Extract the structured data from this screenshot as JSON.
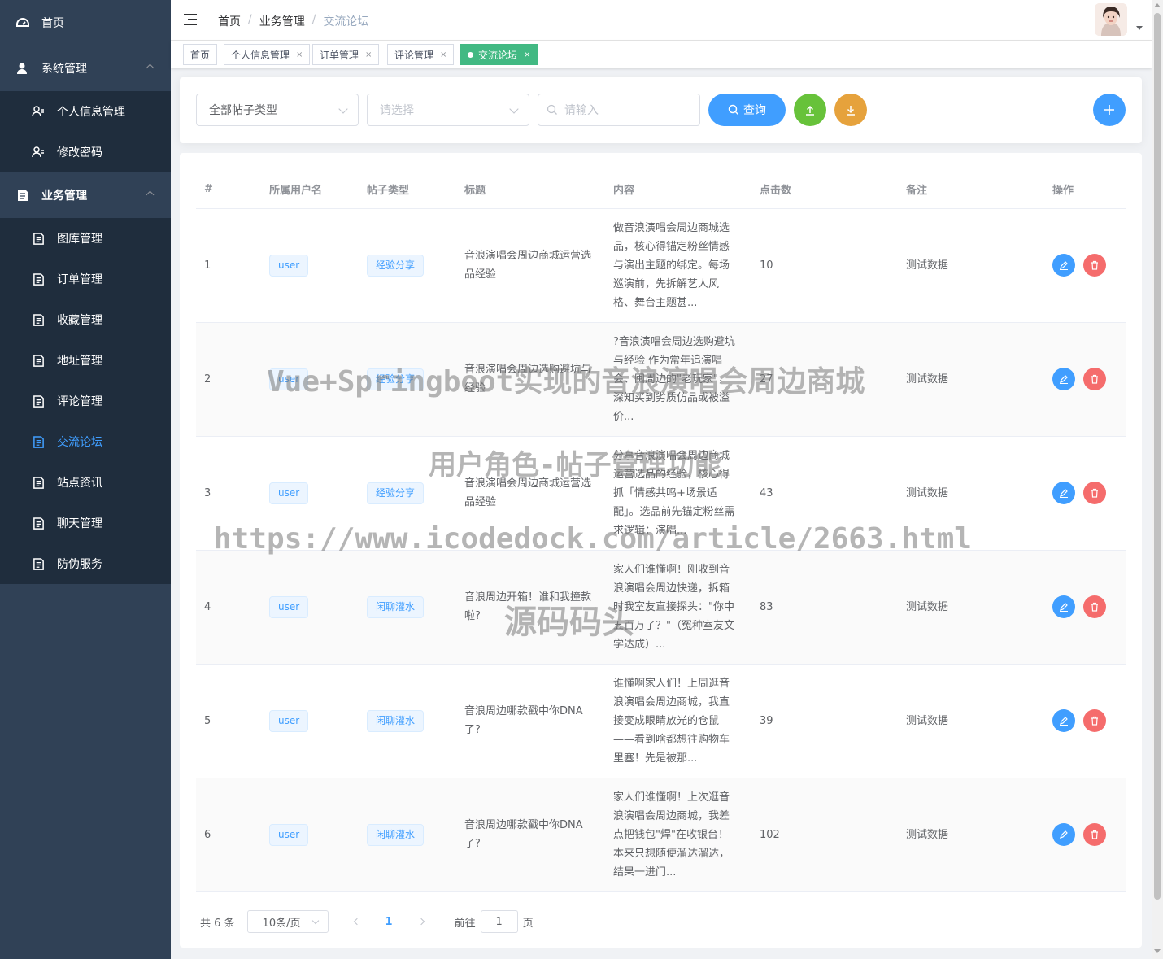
{
  "sidebar": {
    "items": [
      {
        "label": "首页",
        "icon": "dashboard-icon"
      },
      {
        "label": "系统管理",
        "icon": "user-icon",
        "children": [
          {
            "label": "个人信息管理",
            "icon": "peoples-icon"
          },
          {
            "label": "修改密码",
            "icon": "peoples-icon"
          }
        ]
      },
      {
        "label": "业务管理",
        "icon": "form-icon",
        "children": [
          {
            "label": "图库管理",
            "icon": "form-icon"
          },
          {
            "label": "订单管理",
            "icon": "form-icon"
          },
          {
            "label": "收藏管理",
            "icon": "form-icon"
          },
          {
            "label": "地址管理",
            "icon": "form-icon"
          },
          {
            "label": "评论管理",
            "icon": "form-icon"
          },
          {
            "label": "交流论坛",
            "icon": "form-icon",
            "active": true
          },
          {
            "label": "站点资讯",
            "icon": "form-icon"
          },
          {
            "label": "聊天管理",
            "icon": "form-icon"
          },
          {
            "label": "防伪服务",
            "icon": "form-icon"
          }
        ]
      }
    ]
  },
  "breadcrumb": [
    "首页",
    "业务管理",
    "交流论坛"
  ],
  "tags": [
    {
      "label": "首页"
    },
    {
      "label": "个人信息管理",
      "close": "×"
    },
    {
      "label": "订单管理",
      "close": "×"
    },
    {
      "label": "评论管理",
      "close": "×"
    },
    {
      "label": "交流论坛",
      "close": "×",
      "active": true
    }
  ],
  "filter": {
    "type_select": "全部帖子类型",
    "second_select_placeholder": "请选择",
    "search_placeholder": "请输入",
    "query_label": "查询"
  },
  "table": {
    "headers": [
      "#",
      "所属用户名",
      "帖子类型",
      "标题",
      "内容",
      "点击数",
      "备注",
      "操作"
    ],
    "rows": [
      {
        "no": "1",
        "user": "user",
        "type": "经验分享",
        "title": "音浪演唱会周边商城运营选品经验",
        "content": "做音浪演唱会周边商城选品，核心得锚定粉丝情感与演出主题的绑定。每场巡演前，先拆解艺人风格、舞台主题甚...",
        "clicks": "10",
        "remark": "测试数据"
      },
      {
        "no": "2",
        "user": "user",
        "type": "经验分享",
        "title": "音浪演唱会周边选购避坑与经验",
        "content": "?音浪演唱会周边选购避坑与经验 作为常年追演唱会、囤周边的\"老玩家\"，深知买到劣质仿品或被溢价...",
        "clicks": "27",
        "remark": "测试数据"
      },
      {
        "no": "3",
        "user": "user",
        "type": "经验分享",
        "title": "音浪演唱会周边商城运营选品经验",
        "content": "分享音浪演唱会周边商城运营选品的经验，核心得抓「情感共鸣+场景适配」。选品前先锚定粉丝需求逻辑：演唱...",
        "clicks": "43",
        "remark": "测试数据"
      },
      {
        "no": "4",
        "user": "user",
        "type": "闲聊灌水",
        "title": "音浪周边开箱！谁和我撞款啦?",
        "content": "家人们谁懂啊！刚收到音浪演唱会周边快递，拆箱时我室友直接探头：\"你中五百万了？\"（冤种室友文学达成）...",
        "clicks": "83",
        "remark": "测试数据"
      },
      {
        "no": "5",
        "user": "user",
        "type": "闲聊灌水",
        "title": "音浪周边哪款戳中你DNA了?",
        "content": "谁懂啊家人们！上周逛音浪演唱会周边商城，我直接变成眼睛放光的仓鼠——看到啥都想往购物车里塞！先是被那...",
        "clicks": "39",
        "remark": "测试数据"
      },
      {
        "no": "6",
        "user": "user",
        "type": "闲聊灌水",
        "title": "音浪周边哪款戳中你DNA了?",
        "content": "家人们谁懂啊！上次逛音浪演唱会周边商城，我差点把钱包\"焊\"在收银台！本来只想随便溜达溜达，结果一进门...",
        "clicks": "102",
        "remark": "测试数据"
      }
    ]
  },
  "pagination": {
    "total": "共 6 条",
    "page_size": "10条/页",
    "current": "1",
    "goto_prefix": "前往",
    "goto_value": "1",
    "goto_suffix": "页"
  },
  "watermark": {
    "line1": "Vue+Springboot实现的音浪演唱会周边商城",
    "line2": "用户角色-帖子管理功能",
    "line3": "https://www.icodedock.com/article/2663.html",
    "line4": "源码码头"
  },
  "colors": {
    "sidebar_bg": "#304156",
    "submenu_bg": "#1f2d3d",
    "primary": "#409eff",
    "success": "#67c23a",
    "warning": "#e6a23c",
    "danger": "#f56c6c",
    "active_tag": "#42b983"
  }
}
